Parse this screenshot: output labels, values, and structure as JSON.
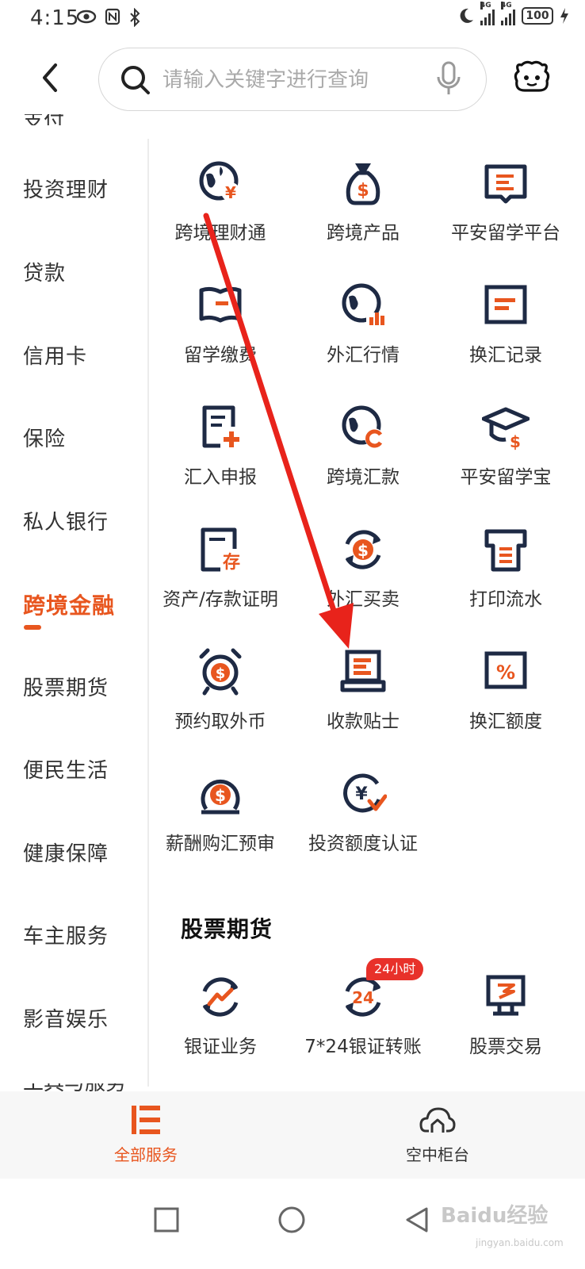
{
  "status_bar": {
    "time": "4:15",
    "battery": "100",
    "network_label": "4G"
  },
  "search": {
    "placeholder": "请输入关键字进行查询"
  },
  "sidebar": {
    "items": [
      {
        "label": "投资理财",
        "active": false
      },
      {
        "label": "贷款",
        "active": false
      },
      {
        "label": "信用卡",
        "active": false
      },
      {
        "label": "保险",
        "active": false
      },
      {
        "label": "私人银行",
        "active": false
      },
      {
        "label": "跨境金融",
        "active": true
      },
      {
        "label": "股票期货",
        "active": false
      },
      {
        "label": "便民生活",
        "active": false
      },
      {
        "label": "健康保障",
        "active": false
      },
      {
        "label": "车主服务",
        "active": false
      },
      {
        "label": "影音娱乐",
        "active": false
      }
    ],
    "partial_top": "支付",
    "partial_bottom": "工具与服务"
  },
  "cross_border": {
    "services": [
      {
        "label": "跨境理财通",
        "icon": "globe-yuan-icon"
      },
      {
        "label": "跨境产品",
        "icon": "money-bag-icon"
      },
      {
        "label": "平安留学平台",
        "icon": "book-icon"
      },
      {
        "label": "留学缴费",
        "icon": "open-book-icon"
      },
      {
        "label": "外汇行情",
        "icon": "globe-chart-icon"
      },
      {
        "label": "换汇记录",
        "icon": "exchange-record-icon"
      },
      {
        "label": "汇入申报",
        "icon": "document-plus-icon"
      },
      {
        "label": "跨境汇款",
        "icon": "globe-transfer-icon"
      },
      {
        "label": "平安留学宝",
        "icon": "graduation-cap-icon"
      },
      {
        "label": "资产/存款证明",
        "icon": "deposit-certificate-icon"
      },
      {
        "label": "外汇买卖",
        "icon": "currency-exchange-icon"
      },
      {
        "label": "打印流水",
        "icon": "printer-icon"
      },
      {
        "label": "预约取外币",
        "icon": "alarm-clock-dollar-icon"
      },
      {
        "label": "收款贴士",
        "icon": "laptop-icon"
      },
      {
        "label": "换汇额度",
        "icon": "percent-icon"
      },
      {
        "label": "薪酬购汇预审",
        "icon": "coin-dollar-icon"
      },
      {
        "label": "投资额度认证",
        "icon": "yuan-check-icon"
      }
    ]
  },
  "stocks": {
    "title": "股票期货",
    "services": [
      {
        "label": "银证业务",
        "icon": "trend-cycle-icon"
      },
      {
        "label": "7*24银证转账",
        "icon": "clock-24-icon"
      },
      {
        "label": "股票交易",
        "icon": "monitor-chart-icon"
      }
    ],
    "badge": "24小时"
  },
  "tab_bar": {
    "tabs": [
      {
        "label": "全部服务",
        "active": true
      },
      {
        "label": "空中柜台",
        "active": false
      }
    ]
  },
  "watermark": {
    "brand": "Baidu经验",
    "site": "jingyan.baidu.com"
  },
  "colors": {
    "accent": "#e8561f",
    "icon_dark": "#1e2a44",
    "arrow": "#e8231b"
  }
}
